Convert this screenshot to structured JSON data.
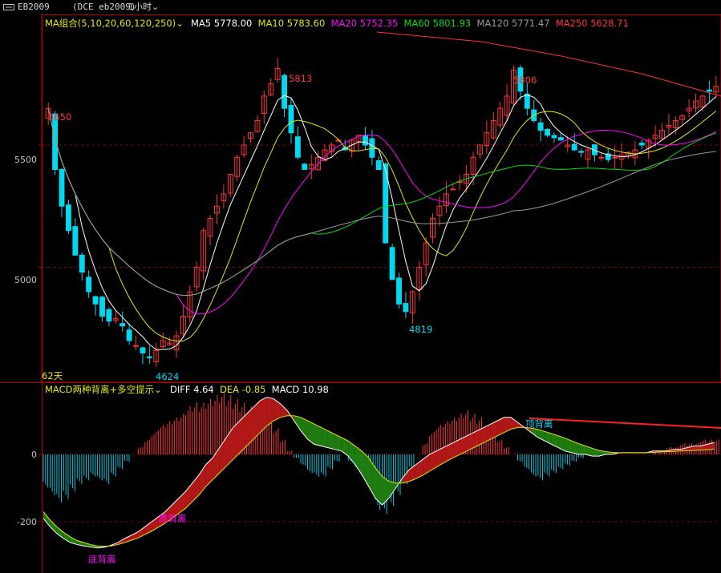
{
  "window": {
    "symbol": "EB2009",
    "exchange": "(DCE eb2009)",
    "period": "1小时"
  },
  "main_panel": {
    "indicator_name": "MA组合(5,10,20,60,120,250)",
    "ma_values": [
      {
        "label": "MA5",
        "value": "5778.00",
        "color": "#ffffff"
      },
      {
        "label": "MA10",
        "value": "5783.60",
        "color": "#e6e600"
      },
      {
        "label": "MA20",
        "value": "5752.35",
        "color": "#ff00ff"
      },
      {
        "label": "MA60",
        "value": "5801.93",
        "color": "#00dd00"
      },
      {
        "label": "MA120",
        "value": "5771.47",
        "color": "#9a9a9a"
      },
      {
        "label": "MA250",
        "value": "5628.71",
        "color": "#ff3030"
      }
    ],
    "y_ticks": [
      "5500",
      "5000"
    ],
    "annotations": {
      "high_left": "5650",
      "peak_mid": "5813",
      "peak_right": "5806",
      "low_left": "4624",
      "low_mid": "4819",
      "days_label": "62天"
    }
  },
  "sub_panel": {
    "indicator_name": "MACD两种背离+多空提示",
    "diff": {
      "label": "DIFF",
      "value": "4.64"
    },
    "dea": {
      "label": "DEA",
      "value": "-0.85"
    },
    "macd": {
      "label": "MACD",
      "value": "10.98"
    },
    "y_ticks": [
      "0",
      "-200"
    ],
    "signals": {
      "bottom_div_1": "底背离",
      "bottom_div_2": "底背离",
      "top_div": "顶背离"
    }
  },
  "chart_data": {
    "type": "candlestick",
    "price_axis": {
      "gridlines": [
        5500,
        5000
      ],
      "top": 5975,
      "bottom": 4530
    },
    "ma_labels_colors": {
      "up": "#ff3333",
      "down": "#00d8f0"
    },
    "close_path": [
      5650,
      5400,
      5250,
      5150,
      5050,
      4980,
      4900,
      4850,
      4800,
      4780,
      4790,
      4760,
      4700,
      4680,
      4650,
      4630,
      4660,
      4700,
      4690,
      4720,
      4800,
      4900,
      5000,
      5150,
      5200,
      5250,
      5300,
      5380,
      5450,
      5500,
      5550,
      5600,
      5700,
      5750,
      5813,
      5650,
      5550,
      5450,
      5400,
      5420,
      5450,
      5480,
      5500,
      5520,
      5480,
      5520,
      5540,
      5500,
      5450,
      5400,
      5100,
      4950,
      4850,
      4819,
      4900,
      5000,
      5100,
      5200,
      5250,
      5300,
      5320,
      5350,
      5380,
      5450,
      5500,
      5550,
      5600,
      5650,
      5700,
      5806,
      5720,
      5650,
      5600,
      5560,
      5540,
      5530,
      5520,
      5500,
      5480,
      5470,
      5480,
      5460,
      5450,
      5440,
      5450,
      5460,
      5470,
      5480,
      5500,
      5520,
      5540,
      5560,
      5580,
      5600,
      5620,
      5650,
      5680,
      5700,
      5720,
      5740
    ],
    "macd_hist": [
      -90,
      -110,
      -130,
      -120,
      -100,
      -80,
      -70,
      -60,
      -70,
      -80,
      -60,
      -40,
      -20,
      0,
      20,
      40,
      60,
      80,
      90,
      100,
      110,
      130,
      140,
      140,
      150,
      160,
      170,
      160,
      150,
      140,
      130,
      120,
      110,
      90,
      70,
      40,
      10,
      -10,
      -30,
      -50,
      -60,
      -60,
      -40,
      -20,
      0,
      -20,
      -40,
      -70,
      -100,
      -150,
      -160,
      -140,
      -110,
      -80,
      -40,
      0,
      30,
      60,
      80,
      90,
      100,
      110,
      120,
      110,
      100,
      80,
      60,
      40,
      20,
      0,
      -20,
      -40,
      -60,
      -70,
      -60,
      -50,
      -40,
      -30,
      -20,
      -10,
      0,
      0,
      0,
      0,
      0,
      0,
      0,
      0,
      0,
      0,
      10,
      10,
      20,
      20,
      30,
      30,
      30,
      40,
      40,
      40
    ],
    "diff_values": [
      -190,
      -215,
      -235,
      -250,
      -262,
      -268,
      -272,
      -275,
      -278,
      -276,
      -270,
      -262,
      -250,
      -240,
      -230,
      -215,
      -200,
      -185,
      -170,
      -150,
      -130,
      -110,
      -85,
      -60,
      -30,
      -10,
      20,
      50,
      80,
      100,
      120,
      140,
      160,
      170,
      165,
      150,
      130,
      100,
      70,
      45,
      30,
      25,
      20,
      15,
      10,
      -5,
      -30,
      -60,
      -95,
      -130,
      -150,
      -130,
      -100,
      -70,
      -45,
      -30,
      -15,
      0,
      10,
      20,
      30,
      40,
      50,
      60,
      70,
      80,
      90,
      100,
      110,
      110,
      95,
      80,
      65,
      50,
      40,
      30,
      20,
      10,
      5,
      0,
      0,
      -5,
      -5,
      0,
      0,
      5,
      5,
      5,
      5,
      5,
      10,
      10,
      10,
      15,
      15,
      20,
      25,
      25,
      30,
      35
    ],
    "dea_values": [
      -170,
      -195,
      -215,
      -232,
      -245,
      -256,
      -262,
      -268,
      -272,
      -273,
      -272,
      -268,
      -262,
      -255,
      -248,
      -238,
      -228,
      -216,
      -204,
      -190,
      -175,
      -160,
      -140,
      -120,
      -95,
      -75,
      -55,
      -35,
      -15,
      5,
      25,
      45,
      65,
      85,
      100,
      110,
      115,
      115,
      110,
      100,
      90,
      80,
      70,
      60,
      50,
      40,
      25,
      10,
      -10,
      -40,
      -65,
      -80,
      -85,
      -85,
      -80,
      -72,
      -62,
      -50,
      -38,
      -26,
      -15,
      -5,
      5,
      15,
      25,
      35,
      45,
      55,
      65,
      75,
      80,
      80,
      78,
      74,
      68,
      62,
      55,
      48,
      40,
      32,
      25,
      18,
      12,
      8,
      6,
      5,
      5,
      5,
      5,
      5,
      6,
      7,
      8,
      9,
      10,
      11,
      12,
      13,
      14,
      16
    ]
  }
}
